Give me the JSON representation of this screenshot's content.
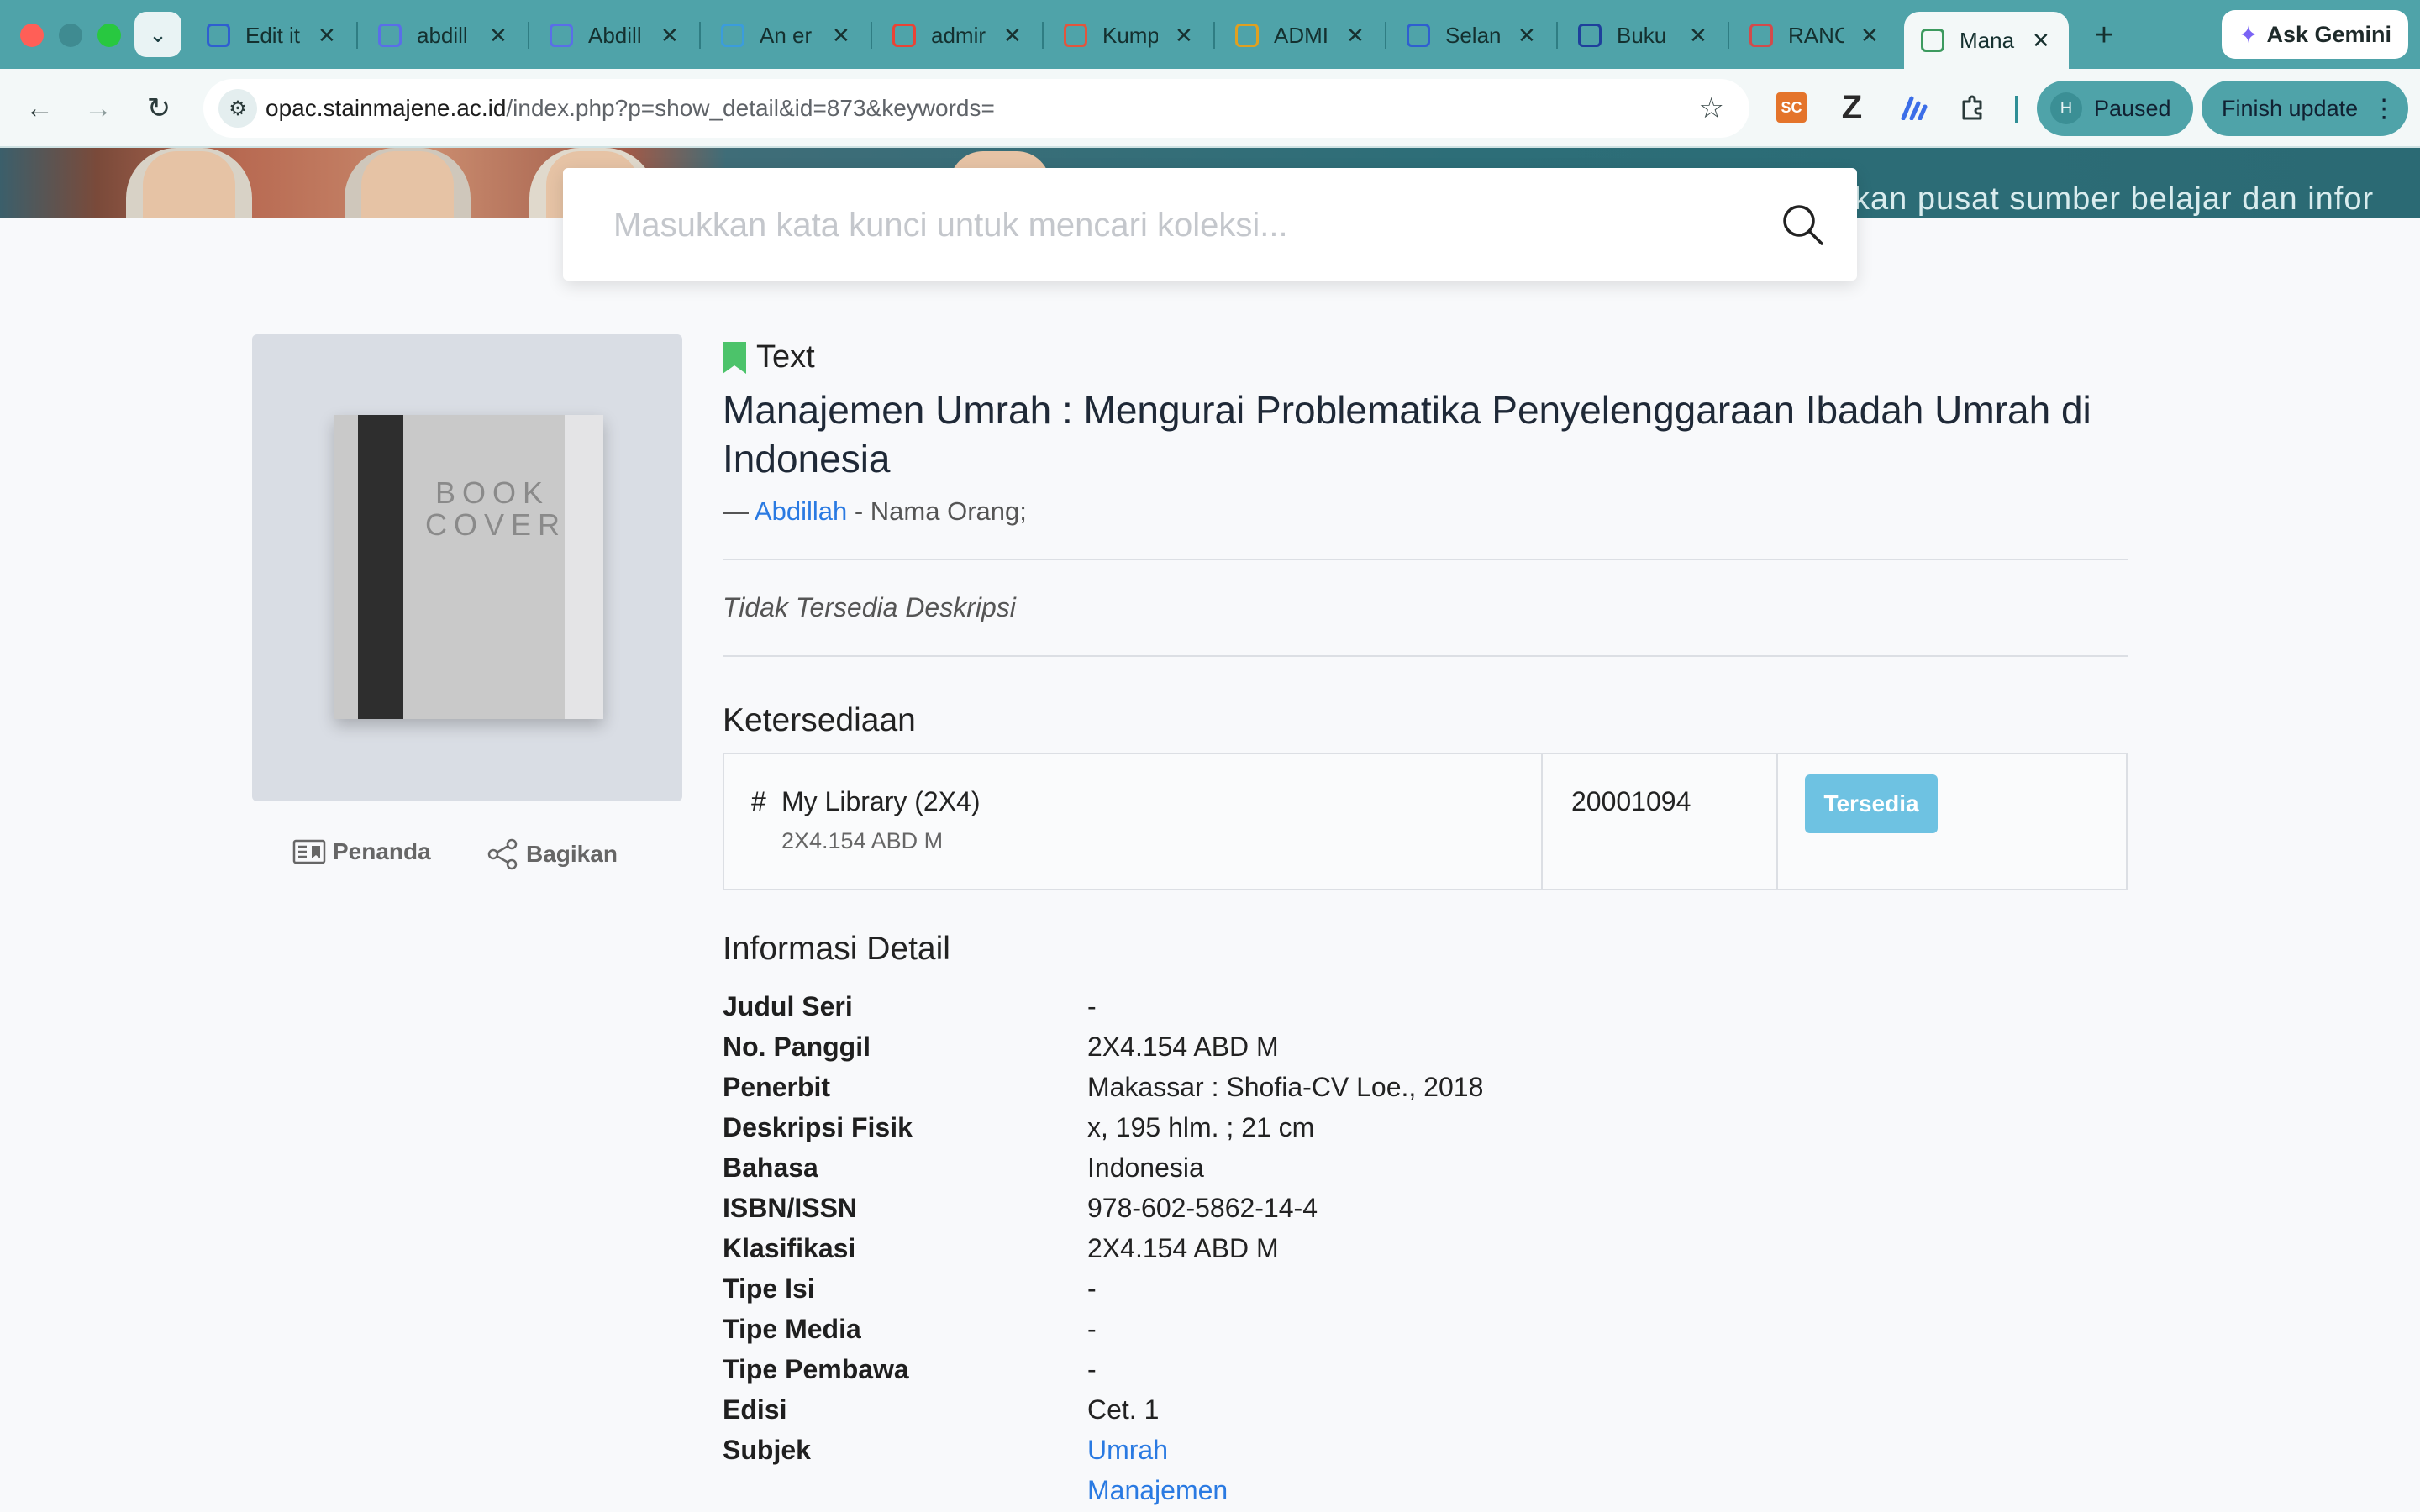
{
  "browser": {
    "tabs": [
      {
        "label": "Edit it",
        "icon": "doc-icon",
        "color": "#2f5fd0"
      },
      {
        "label": "abdill",
        "icon": "layers-icon",
        "color": "#5a6ee8"
      },
      {
        "label": "Abdill",
        "icon": "layers-icon",
        "color": "#5a6ee8"
      },
      {
        "label": "An er",
        "icon": "shield-icon",
        "color": "#3b9cdc"
      },
      {
        "label": "admir",
        "icon": "google-icon",
        "color": "#ea4335"
      },
      {
        "label": "Kump",
        "icon": "bird-icon",
        "color": "#e2553d"
      },
      {
        "label": "ADMI",
        "icon": "key-icon",
        "color": "#e0a020"
      },
      {
        "label": "Selan",
        "icon": "doc-icon",
        "color": "#2f5fd0"
      },
      {
        "label": "Buku",
        "icon": "info-icon",
        "color": "#1e3f9c"
      },
      {
        "label": "RANC",
        "icon": "page-icon",
        "color": "#d24b4b"
      },
      {
        "label": "Mana",
        "icon": "tree-icon",
        "color": "#3c9a5f"
      }
    ],
    "new_tab": "+",
    "ask_gemini": "Ask Gemini",
    "url_host": "opac.stainmajene.ac.id",
    "url_rest": "/index.php?p=show_detail&id=873&keywords=",
    "ext_sc": "SC",
    "ext_z": "Z",
    "profile_initial": "H",
    "profile_status": "Paused",
    "finish_update": "Finish update"
  },
  "banner": {
    "text": "kan pusat sumber belajar dan infor"
  },
  "search": {
    "placeholder": "Masukkan kata kunci untuk mencari koleksi..."
  },
  "cover": {
    "line1": "BOOK",
    "line2": "COVER"
  },
  "actions": {
    "bookmark": "Penanda",
    "share": "Bagikan"
  },
  "item": {
    "type": "Text",
    "title": "Manajemen Umrah : Mengurai Problematika Penyelenggaraan Ibadah Umrah di Indonesia",
    "author_prefix": "—",
    "author": "Abdillah",
    "author_suffix": "- Nama Orang;",
    "description": "Tidak Tersedia Deskripsi"
  },
  "availability": {
    "title": "Ketersediaan",
    "hash": "#",
    "location": "My Library (2X4)",
    "call_number": "2X4.154 ABD M",
    "item_code": "20001094",
    "status": "Tersedia"
  },
  "detail": {
    "title": "Informasi Detail",
    "rows": [
      {
        "key": "Judul Seri",
        "value": "-"
      },
      {
        "key": "No. Panggil",
        "value": "2X4.154 ABD M"
      },
      {
        "key": "Penerbit",
        "value": "Makassar : Shofia-CV Loe., 2018"
      },
      {
        "key": "Deskripsi Fisik",
        "value": "x, 195 hlm. ; 21 cm"
      },
      {
        "key": "Bahasa",
        "value": "Indonesia"
      },
      {
        "key": "ISBN/ISSN",
        "value": "978-602-5862-14-4"
      },
      {
        "key": "Klasifikasi",
        "value": "2X4.154 ABD M"
      },
      {
        "key": "Tipe Isi",
        "value": "-"
      },
      {
        "key": "Tipe Media",
        "value": "-"
      },
      {
        "key": "Tipe Pembawa",
        "value": "-"
      },
      {
        "key": "Edisi",
        "value": "Cet. 1"
      },
      {
        "key": "Subjek",
        "value": ""
      }
    ],
    "subjects": [
      "Umrah",
      "Manajemen"
    ]
  },
  "colors": {
    "chrome": "#4fa3a9",
    "link": "#2a7ae2",
    "badge": "#6ec2e2"
  }
}
